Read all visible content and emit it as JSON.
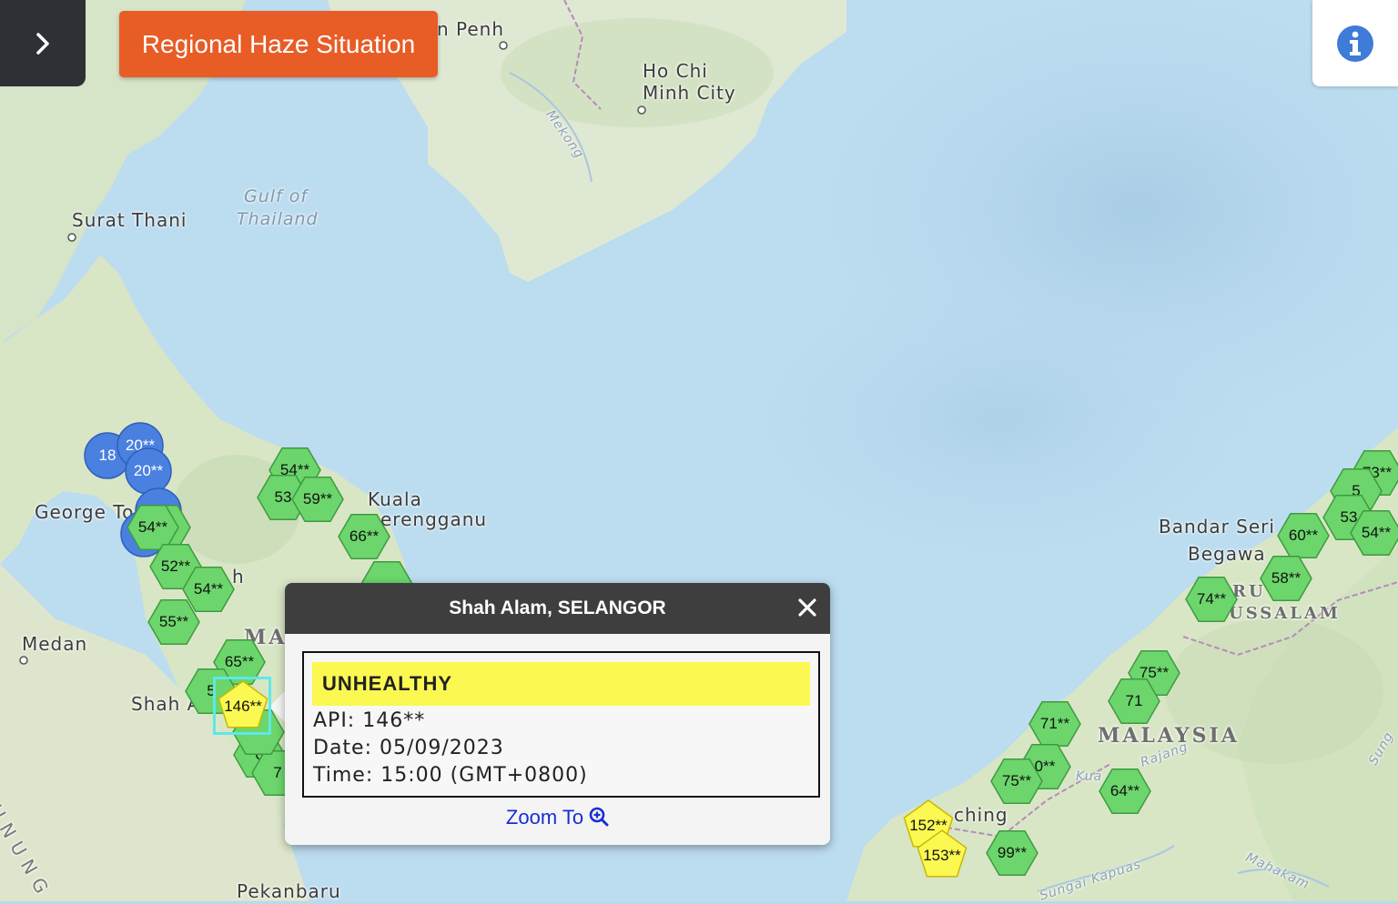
{
  "header": {
    "title": "Regional Haze Situation",
    "accent_color": "#e85c26"
  },
  "controls": {
    "sidebar_toggle_icon": "chevron-right-icon",
    "info_icon": "info-circle-icon",
    "info_color": "#3f7bd8"
  },
  "map_labels": [
    {
      "id": "phnom-penh",
      "text": "n Penh"
    },
    {
      "id": "ho-chi-minh-1",
      "text": "Ho Chi"
    },
    {
      "id": "ho-chi-minh-2",
      "text": "Minh City"
    },
    {
      "id": "mekong",
      "text": "Mekong"
    },
    {
      "id": "gulf-1",
      "text": "Gulf of"
    },
    {
      "id": "gulf-2",
      "text": "Thailand"
    },
    {
      "id": "surat-thani",
      "text": "Surat Thani"
    },
    {
      "id": "george-town",
      "text": "George To"
    },
    {
      "id": "kuala-t-1",
      "text": "Kuala"
    },
    {
      "id": "kuala-t-2",
      "text": "erengganu"
    },
    {
      "id": "ipoh",
      "text": "h"
    },
    {
      "id": "medan",
      "text": "Medan"
    },
    {
      "id": "shah-alam",
      "text": "Shah A"
    },
    {
      "id": "ma",
      "text": "MA"
    },
    {
      "id": "pekanbaru",
      "text": "Pekanbaru"
    },
    {
      "id": "gunung",
      "text": "G U N U N G"
    },
    {
      "id": "bandar-1",
      "text": "Bandar Seri"
    },
    {
      "id": "bandar-2",
      "text": "Begawa"
    },
    {
      "id": "brunei-1",
      "text": "RU"
    },
    {
      "id": "brunei-2",
      "text": "USSALAM"
    },
    {
      "id": "malaysia",
      "text": "MALAYSIA"
    },
    {
      "id": "kuching",
      "text": "ching"
    },
    {
      "id": "rajang",
      "text": "Rajang"
    },
    {
      "id": "kua",
      "text": "Kua"
    },
    {
      "id": "kapuas",
      "text": "Sungai Kapuas"
    },
    {
      "id": "mahakam",
      "text": "Mahakam"
    },
    {
      "id": "sungai",
      "text": "Sung"
    }
  ],
  "stations": [
    {
      "label": "18",
      "color": "#4a80e0",
      "shape": "circle"
    },
    {
      "label": "20**",
      "color": "#4a80e0",
      "shape": "circle"
    },
    {
      "label": "20**",
      "color": "#4a80e0",
      "shape": "circle"
    },
    {
      "label": "",
      "color": "#4a80e0",
      "shape": "circle"
    },
    {
      "label": "",
      "color": "#4a80e0",
      "shape": "circle"
    },
    {
      "label": "*",
      "color": "#6cd66c",
      "shape": "hexagon"
    },
    {
      "label": "54**",
      "color": "#6cd66c",
      "shape": "hexagon"
    },
    {
      "label": "52**",
      "color": "#6cd66c",
      "shape": "hexagon"
    },
    {
      "label": "54**",
      "color": "#6cd66c",
      "shape": "hexagon"
    },
    {
      "label": "55**",
      "color": "#6cd66c",
      "shape": "hexagon"
    },
    {
      "label": "54**",
      "color": "#6cd66c",
      "shape": "hexagon"
    },
    {
      "label": "53",
      "color": "#6cd66c",
      "shape": "hexagon"
    },
    {
      "label": "59**",
      "color": "#6cd66c",
      "shape": "hexagon"
    },
    {
      "label": "66**",
      "color": "#6cd66c",
      "shape": "hexagon"
    },
    {
      "label": "",
      "color": "#6cd66c",
      "shape": "hexagon"
    },
    {
      "label": "65**",
      "color": "#6cd66c",
      "shape": "hexagon"
    },
    {
      "label": "5",
      "color": "#6cd66c",
      "shape": "hexagon"
    },
    {
      "label": "6",
      "color": "#6cd66c",
      "shape": "hexagon"
    },
    {
      "label": "7",
      "color": "#6cd66c",
      "shape": "hexagon"
    },
    {
      "label": "146**",
      "color": "#fbf851",
      "shape": "pentagon"
    },
    {
      "label": "",
      "color": "#6cd66c",
      "shape": "hexagon"
    },
    {
      "label": "73**",
      "color": "#6cd66c",
      "shape": "hexagon"
    },
    {
      "label": "5",
      "color": "#6cd66c",
      "shape": "hexagon"
    },
    {
      "label": "53",
      "color": "#6cd66c",
      "shape": "hexagon"
    },
    {
      "label": "54**",
      "color": "#6cd66c",
      "shape": "hexagon"
    },
    {
      "label": "60**",
      "color": "#6cd66c",
      "shape": "hexagon"
    },
    {
      "label": "58**",
      "color": "#6cd66c",
      "shape": "hexagon"
    },
    {
      "label": "74**",
      "color": "#6cd66c",
      "shape": "hexagon"
    },
    {
      "label": "75**",
      "color": "#6cd66c",
      "shape": "hexagon"
    },
    {
      "label": "71",
      "color": "#6cd66c",
      "shape": "hexagon"
    },
    {
      "label": "71**",
      "color": "#6cd66c",
      "shape": "hexagon"
    },
    {
      "label": "0**",
      "color": "#6cd66c",
      "shape": "hexagon"
    },
    {
      "label": "75**",
      "color": "#6cd66c",
      "shape": "hexagon"
    },
    {
      "label": "64**",
      "color": "#6cd66c",
      "shape": "hexagon"
    },
    {
      "label": "99**",
      "color": "#6cd66c",
      "shape": "hexagon"
    },
    {
      "label": "152**",
      "color": "#fbf851",
      "shape": "pentagon"
    },
    {
      "label": "153**",
      "color": "#fbf851",
      "shape": "pentagon"
    }
  ],
  "popup": {
    "title": "Shah Alam, SELANGOR",
    "close_icon": "close-icon",
    "status": "UNHEALTHY",
    "status_color": "#fbf851",
    "api_line": "API: 146**",
    "date_line": "Date: 05/09/2023",
    "time_line": "Time: 15:00 (GMT+0800)",
    "zoom_label": "Zoom To",
    "zoom_icon": "zoom-in-icon"
  }
}
